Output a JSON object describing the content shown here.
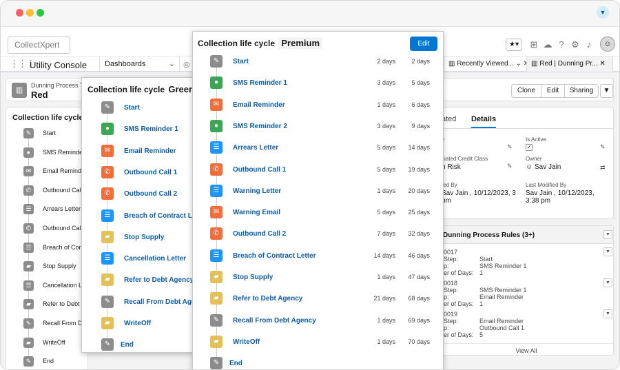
{
  "colors": {
    "gray": "#8c8c8c",
    "green": "#3ba755",
    "red": "#ef6e3b",
    "blue": "#1b96ff",
    "yellow": "#e4c059",
    "brand": "#0176d3"
  },
  "header": {
    "logo": "CollectXpert"
  },
  "nav": {
    "app": "Utility Console",
    "dropdown": "Dashboards",
    "tabs": [
      "Recently Viewed...",
      "Red | Dunning Pr..."
    ]
  },
  "record": {
    "subtitle": "Dunning Process Te",
    "title": "Red",
    "buttons": [
      "Clone",
      "Edit",
      "Sharing"
    ]
  },
  "left": {
    "title": "Collection life cycle",
    "steps": [
      {
        "label": "Start",
        "icon": "wrench-icon",
        "color": "gray"
      },
      {
        "label": "SMS Reminde",
        "icon": "chat-icon",
        "color": "gray"
      },
      {
        "label": "Email Remind",
        "icon": "mail-icon",
        "color": "gray"
      },
      {
        "label": "Outbound Cal",
        "icon": "phone-icon",
        "color": "gray"
      },
      {
        "label": "Arrears Letter",
        "icon": "document-icon",
        "color": "gray"
      },
      {
        "label": "Outbound Cal",
        "icon": "phone-icon",
        "color": "gray"
      },
      {
        "label": "Breach of Cor",
        "icon": "document-icon",
        "color": "gray"
      },
      {
        "label": "Stop Supply",
        "icon": "truck-icon",
        "color": "gray"
      },
      {
        "label": "Cancellation L",
        "icon": "document-icon",
        "color": "gray"
      },
      {
        "label": "Refer to Debt",
        "icon": "truck-icon",
        "color": "gray"
      },
      {
        "label": "Recall From D",
        "icon": "wrench-icon",
        "color": "gray"
      },
      {
        "label": "WriteOff",
        "icon": "truck-icon",
        "color": "gray"
      },
      {
        "label": "End",
        "icon": "wrench-icon",
        "color": "gray"
      }
    ]
  },
  "details": {
    "tabs": [
      "ated",
      "Details"
    ],
    "fields": [
      {
        "label": "e",
        "value": ""
      },
      {
        "label": "Is Active",
        "value": "✓"
      },
      {
        "label": "ciated Credit Class",
        "value": "h Risk"
      },
      {
        "label": "Owner",
        "value": "Sav Jain"
      },
      {
        "label": "ted By",
        "value": "Sav Jain , 10/12/2023, 3 pm"
      },
      {
        "label": "Last Modified By",
        "value": "Sav Jain , 10/12/2023, 3:38 pm"
      }
    ]
  },
  "rules": {
    "title": "Dunning Process Rules (3+)",
    "items": [
      {
        "id": "0017",
        "step_label": "Step:",
        "prev": "Start",
        "cur": "SMS Reminder 1",
        "days": "1",
        "ofdays": "er of Days:",
        "p": "p:"
      },
      {
        "id": "0018",
        "step_label": "Step:",
        "prev": "SMS Reminder 1",
        "cur": "Email Reminder",
        "days": "1",
        "ofdays": "er of Days:",
        "p": "p:"
      },
      {
        "id": "0019",
        "step_label": "Step:",
        "prev": "Email Reminder",
        "cur": "Outbound Call 1",
        "days": "5",
        "ofdays": "er of Days:",
        "p": "p:"
      }
    ],
    "view_all": "View All"
  },
  "green": {
    "title": "Collection life cycle",
    "name": "Green",
    "steps": [
      {
        "label": "Start",
        "icon": "wrench-icon",
        "color": "gray"
      },
      {
        "label": "SMS Reminder 1",
        "icon": "chat-icon",
        "color": "green"
      },
      {
        "label": "Email Reminder",
        "icon": "mail-icon",
        "color": "red"
      },
      {
        "label": "Outbound Call 1",
        "icon": "phone-icon",
        "color": "red"
      },
      {
        "label": "Outbound Call 2",
        "icon": "phone-icon",
        "color": "red"
      },
      {
        "label": "Breach of Contract Le",
        "icon": "document-icon",
        "color": "blue"
      },
      {
        "label": "Stop Supply",
        "icon": "truck-icon",
        "color": "yellow"
      },
      {
        "label": "Cancellation Letter",
        "icon": "document-icon",
        "color": "blue"
      },
      {
        "label": "Refer to Debt Agency",
        "icon": "truck-icon",
        "color": "yellow"
      },
      {
        "label": "Recall From Debt Age",
        "icon": "wrench-icon",
        "color": "gray"
      },
      {
        "label": "WriteOff",
        "icon": "truck-icon",
        "color": "yellow"
      }
    ],
    "end": "End"
  },
  "premium": {
    "title": "Collection life cycle",
    "name": "Premium",
    "edit": "Edit",
    "steps": [
      {
        "label": "Start",
        "icon": "wrench-icon",
        "color": "gray",
        "d1": "2 days",
        "d2": "2 days"
      },
      {
        "label": "SMS Reminder 1",
        "icon": "chat-icon",
        "color": "green",
        "d1": "3 days",
        "d2": "5 days"
      },
      {
        "label": "Email Reminder",
        "icon": "mail-icon",
        "color": "red",
        "d1": "1 days",
        "d2": "6 days"
      },
      {
        "label": "SMS Reminder 2",
        "icon": "chat-icon",
        "color": "green",
        "d1": "3 days",
        "d2": "9 days"
      },
      {
        "label": "Arrears Letter",
        "icon": "document-icon",
        "color": "blue",
        "d1": "5 days",
        "d2": "14 days"
      },
      {
        "label": "Outbound Call 1",
        "icon": "phone-icon",
        "color": "red",
        "d1": "5 days",
        "d2": "19 days"
      },
      {
        "label": "Warning Letter",
        "icon": "document-icon",
        "color": "blue",
        "d1": "1 days",
        "d2": "20 days"
      },
      {
        "label": "Warning Email",
        "icon": "mail-icon",
        "color": "red",
        "d1": "5 days",
        "d2": "25 days"
      },
      {
        "label": "Outbound Call 2",
        "icon": "phone-icon",
        "color": "red",
        "d1": "7 days",
        "d2": "32 days"
      },
      {
        "label": "Breach of Contract Letter",
        "icon": "document-icon",
        "color": "blue",
        "d1": "14 days",
        "d2": "46 days"
      },
      {
        "label": "Stop Supply",
        "icon": "truck-icon",
        "color": "yellow",
        "d1": "1 days",
        "d2": "47 days"
      },
      {
        "label": "Refer to Debt Agency",
        "icon": "truck-icon",
        "color": "yellow",
        "d1": "21 days",
        "d2": "68 days"
      },
      {
        "label": "Recall From Debt Agency",
        "icon": "wrench-icon",
        "color": "gray",
        "d1": "1 days",
        "d2": "69 days"
      },
      {
        "label": "WriteOff",
        "icon": "truck-icon",
        "color": "yellow",
        "d1": "1 days",
        "d2": "70 days"
      }
    ],
    "end": "End"
  }
}
